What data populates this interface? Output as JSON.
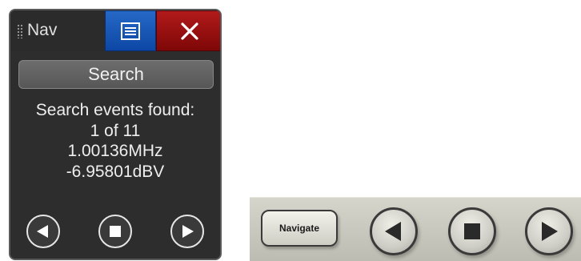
{
  "nav_panel": {
    "title": "Nav",
    "menu_button_icon": "menu-list-icon",
    "close_button_icon": "close-icon",
    "search_label": "Search",
    "info": {
      "line1": "Search events found:",
      "line2": "1 of 11",
      "frequency": "1.00136MHz",
      "amplitude": "-6.95801dBV"
    },
    "controls": [
      "previous-icon",
      "stop-icon",
      "next-icon"
    ],
    "colors": {
      "panel_bg": "#2d2d2d",
      "menu_button": "#1559b8",
      "close_button": "#9c1010",
      "text": "#eeeeee"
    }
  },
  "toolbar": {
    "navigate_label": "Navigate",
    "controls": [
      "previous-icon",
      "stop-icon",
      "next-icon"
    ],
    "colors": {
      "strip_bg": "#cac9bf",
      "button_outline": "#3a3a3a"
    }
  }
}
